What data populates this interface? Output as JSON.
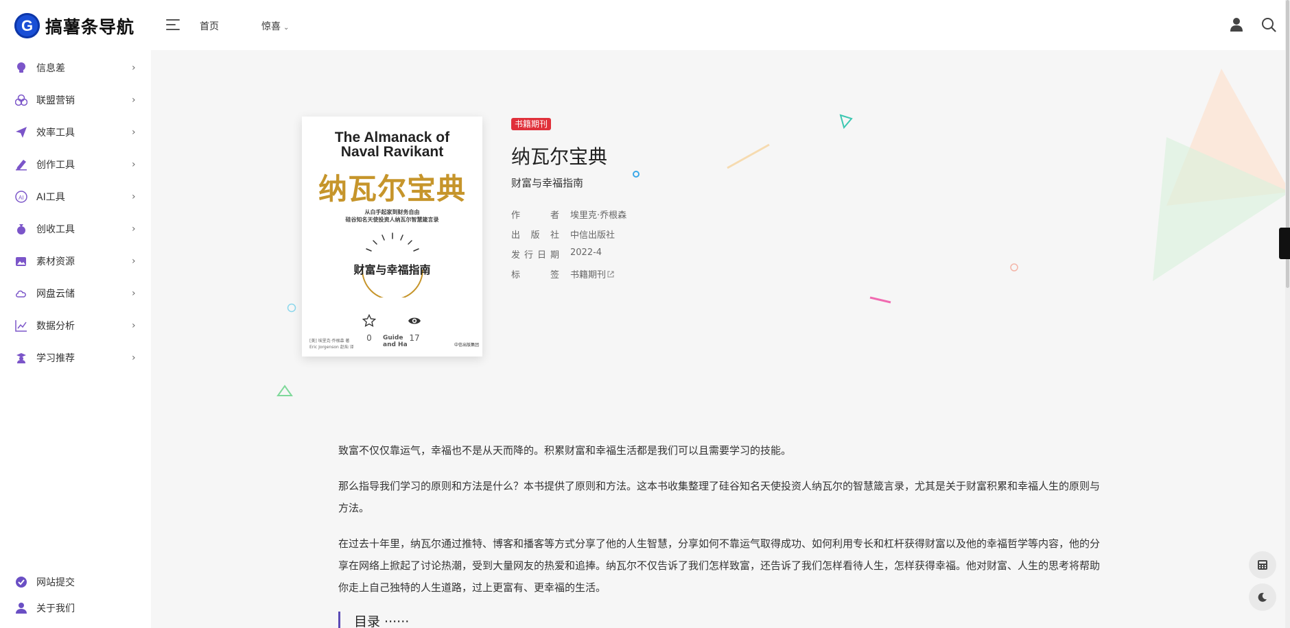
{
  "header": {
    "logo_letter": "G",
    "site_name": "搞薯条导航",
    "nav_home": "首页",
    "nav_surprise": "惊喜",
    "nav_surprise_caret": "⌄"
  },
  "sidebar": {
    "items": [
      {
        "label": "信息差",
        "icon": "lightbulb-icon"
      },
      {
        "label": "联盟营销",
        "icon": "circles-icon"
      },
      {
        "label": "效率工具",
        "icon": "paper-plane-icon"
      },
      {
        "label": "创作工具",
        "icon": "pen-icon"
      },
      {
        "label": "AI工具",
        "icon": "ai-icon"
      },
      {
        "label": "创收工具",
        "icon": "money-bag-icon"
      },
      {
        "label": "素材资源",
        "icon": "image-icon"
      },
      {
        "label": "网盘云储",
        "icon": "cloud-icon"
      },
      {
        "label": "数据分析",
        "icon": "chart-icon"
      },
      {
        "label": "学习推荐",
        "icon": "student-icon"
      }
    ],
    "arrow": "›",
    "bottom": [
      {
        "label": "网站提交",
        "icon": "check-circle-icon"
      },
      {
        "label": "关于我们",
        "icon": "user-icon"
      }
    ]
  },
  "book": {
    "badge": "书籍期刊",
    "title": "纳瓦尔宝典",
    "subtitle": "财富与幸福指南",
    "meta": [
      {
        "key": "作者",
        "value": "埃里克·乔根森"
      },
      {
        "key": "出版社",
        "value": "中信出版社"
      },
      {
        "key": "发行日期",
        "value": "2022-4"
      },
      {
        "key": "标签",
        "value": "书籍期刊"
      }
    ],
    "cover": {
      "en_line1": "The Almanack of",
      "en_line2": "Naval Ravikant",
      "zh_title": "纳瓦尔宝典",
      "small_line1": "从白手起家到财务自由",
      "small_line2": "硅谷知名天使投资人纳瓦尔智慧箴言录",
      "zh_subtitle": "财富与幸福指南",
      "author_small": "[美] 埃里克·乔根森 著",
      "author_small2": "Eric Jorgenson  赵灿 译",
      "en_ghost": "Guide\nand Ha",
      "publisher_small": "中信出版集团"
    },
    "likes": "0",
    "views": "17"
  },
  "paragraphs": [
    "致富不仅仅靠运气，幸福也不是从天而降的。积累财富和幸福生活都是我们可以且需要学习的技能。",
    "那么指导我们学习的原则和方法是什么？本书提供了原则和方法。这本书收集整理了硅谷知名天使投资人纳瓦尔的智慧箴言录，尤其是关于财富积累和幸福人生的原则与方法。",
    "在过去十年里，纳瓦尔通过推特、博客和播客等方式分享了他的人生智慧，分享如何不靠运气取得成功、如何利用专长和杠杆获得财富以及他的幸福哲学等内容，他的分享在网络上掀起了讨论热潮，受到大量网友的热爱和追捧。纳瓦尔不仅告诉了我们怎样致富，还告诉了我们怎样看待人生，怎样获得幸福。他对财富、人生的思考将帮助你走上自己独特的人生道路，过上更富有、更幸福的生活。"
  ],
  "toc_heading": "目录 ······",
  "colors": {
    "accent": "#5b4bb5",
    "badge": "#e0303a",
    "logo": "#1a4fd6",
    "cover_gold": "#c6952b"
  }
}
